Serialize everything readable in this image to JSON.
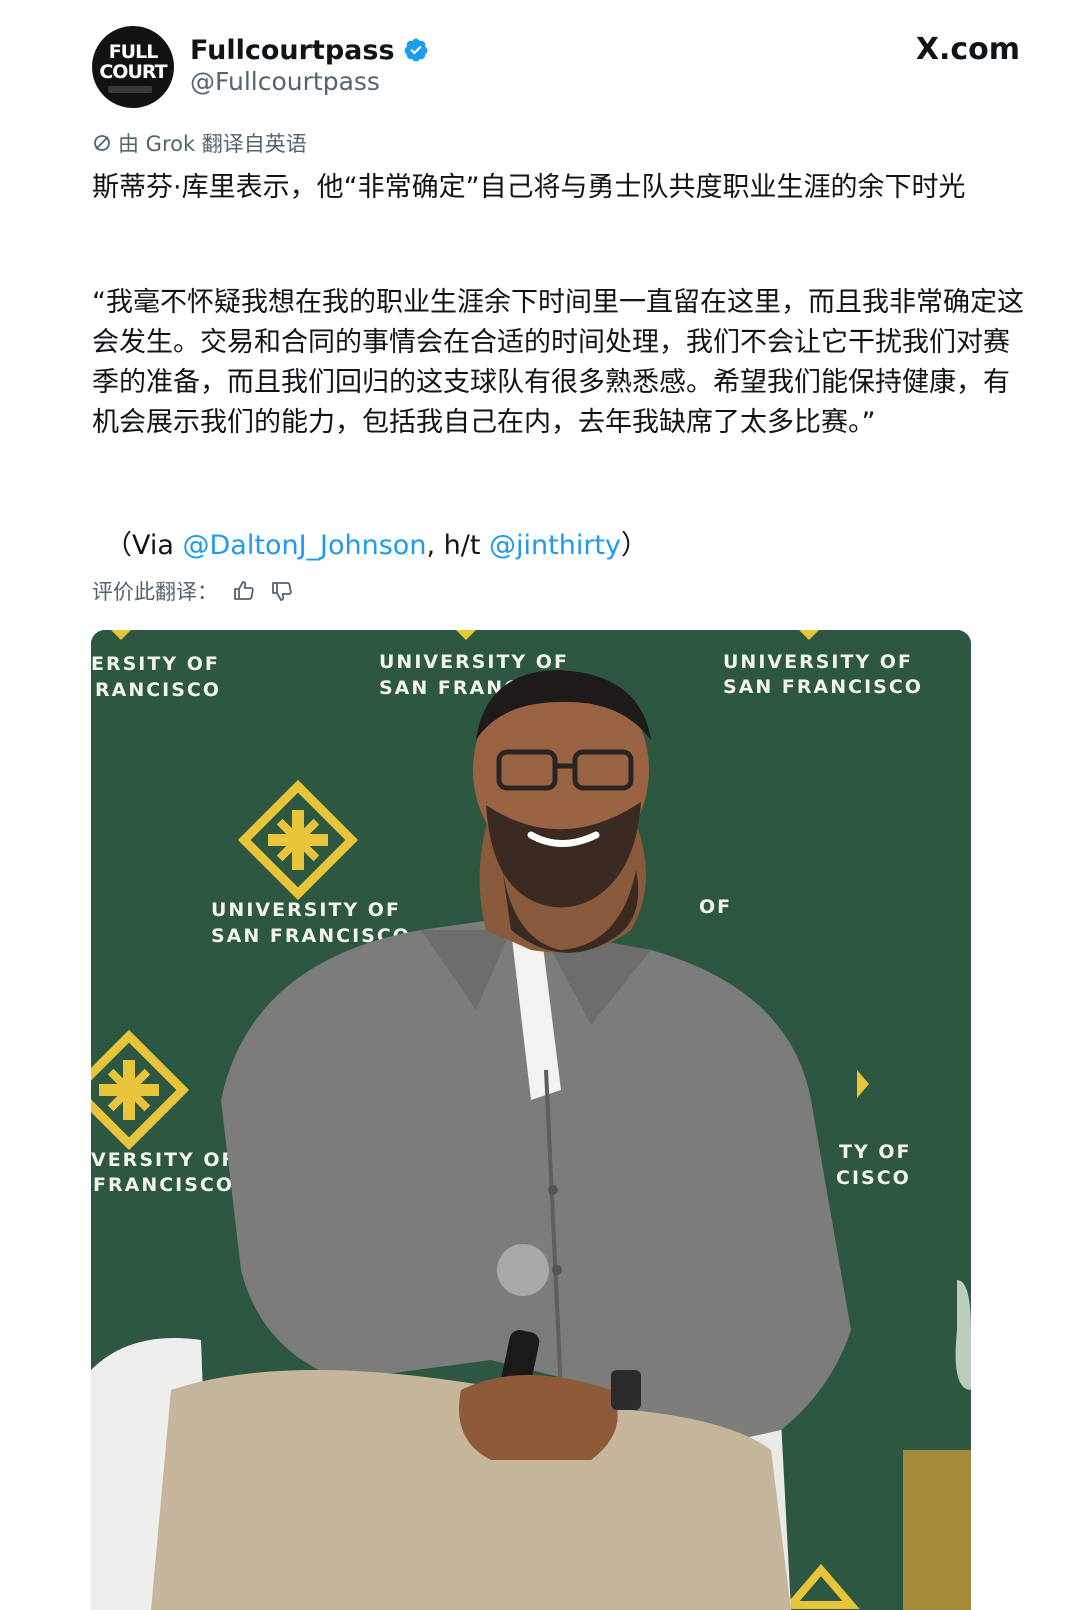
{
  "header": {
    "avatar_logo_line1": "FULL",
    "avatar_logo_line2": "COURT",
    "display_name": "Fullcourtpass",
    "handle": "@Fullcourtpass",
    "site": "X.com"
  },
  "translation": {
    "notice": "由 Grok 翻译自英语",
    "rate_label": "评价此翻译："
  },
  "tweet": {
    "title": "斯蒂芬·库里表示，他“非常确定”自己将与勇士队共度职业生涯的余下时光",
    "quote": "“我毫不怀疑我想在我的职业生涯余下时间里一直留在这里，而且我非常确定这会发生。交易和合同的事情会在合适的时间处理，我们不会让它干扰我们对赛季的准备，而且我们回归的这支球队有很多熟悉感。希望我们能保持健康，有机会展示我们的能力，包括我自己在内，去年我缺席了太多比赛。”",
    "via_prefix": "（Via ",
    "mention1": "@DaltonJ_Johnson",
    "via_mid": ", h/t ",
    "mention2": "@jinthirty",
    "via_suffix": "）"
  },
  "photo": {
    "backdrop_text_line1": "UNIVERSITY OF",
    "backdrop_text_line2": "SAN FRANCISCO",
    "partial_top_left_1": "ERSITY OF",
    "partial_top_left_2": "RANCISCO",
    "partial_left_1": "VERSITY OF",
    "partial_left_2": "FRANCISCO",
    "partial_right_1": "TY OF",
    "partial_right_2": "CISCO",
    "partial_mid": "OF"
  },
  "colors": {
    "accent": "#1d9bf0",
    "text": "#0f1419",
    "muted": "#536471",
    "backdrop_green": "#2d5741",
    "logo_gold": "#e8c43a"
  }
}
